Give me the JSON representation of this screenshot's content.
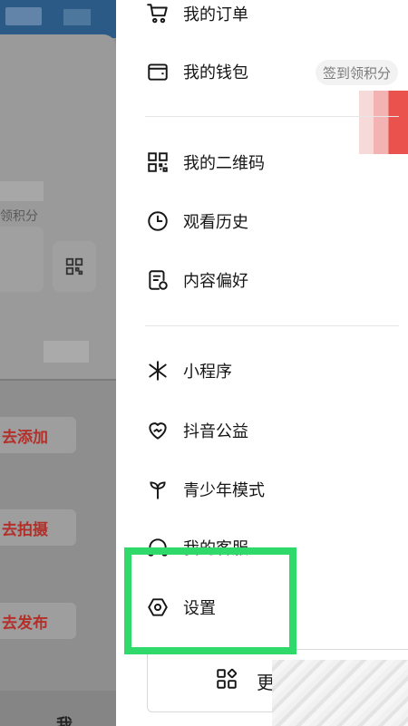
{
  "background_page": {
    "points_text": "领积分",
    "actions": [
      "去添加",
      "去拍摄",
      "去发布"
    ],
    "bottom_tab_me": "我"
  },
  "drawer": {
    "sign_badge": "签到领积分",
    "items": [
      {
        "label": "我的订单",
        "icon": "cart-icon"
      },
      {
        "label": "我的钱包",
        "icon": "wallet-icon"
      },
      {
        "label": "我的二维码",
        "icon": "qrcode-icon"
      },
      {
        "label": "观看历史",
        "icon": "clock-icon"
      },
      {
        "label": "内容偏好",
        "icon": "preference-icon"
      },
      {
        "label": "小程序",
        "icon": "mini-program-icon"
      },
      {
        "label": "抖音公益",
        "icon": "heart-charity-icon"
      },
      {
        "label": "青少年模式",
        "icon": "sprout-icon"
      },
      {
        "label": "我的客服",
        "icon": "headset-icon"
      },
      {
        "label": "设置",
        "icon": "settings-hexagon-icon"
      }
    ],
    "more_button": {
      "label": "更",
      "icon": "grid-icon"
    }
  },
  "colors": {
    "highlight_border": "#2fd96a",
    "action_text": "#b3302a",
    "header_blue": "#2c5a86"
  }
}
